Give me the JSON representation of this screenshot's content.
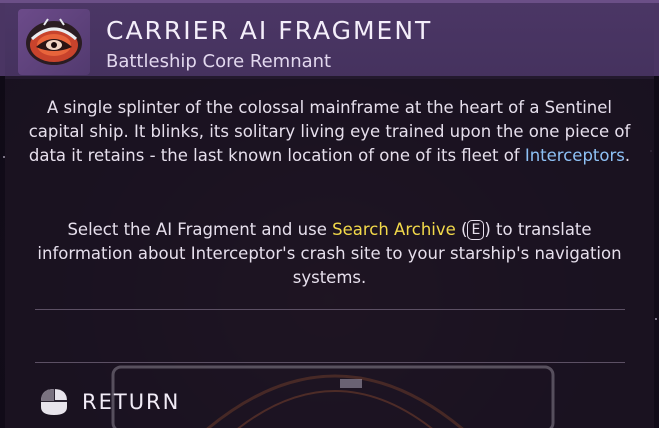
{
  "header": {
    "title": "CARRIER AI FRAGMENT",
    "subtitle": "Battleship Core Remnant",
    "icon": "ai-fragment-eye-icon"
  },
  "description": {
    "text_before": "A single splinter of the colossal mainframe at the heart of a Sentinel capital ship. It blinks, its solitary living eye trained upon the one piece of data it retains - the last known location of one of its fleet of ",
    "highlight": "Interceptors",
    "text_after": "."
  },
  "instruction": {
    "text_before": "Select the AI Fragment and use ",
    "action": "Search Archive",
    "paren_open": " (",
    "key": "E",
    "text_after": ") to translate information about Interceptor's crash site to your starship's navigation systems."
  },
  "footer": {
    "return_label": "RETURN",
    "return_icon": "mouse-click-icon"
  },
  "colors": {
    "header_bg": "#4a3563",
    "link_blue": "#8ec1f5",
    "action_yellow": "#f2d94a",
    "text": "#e6dfec"
  }
}
